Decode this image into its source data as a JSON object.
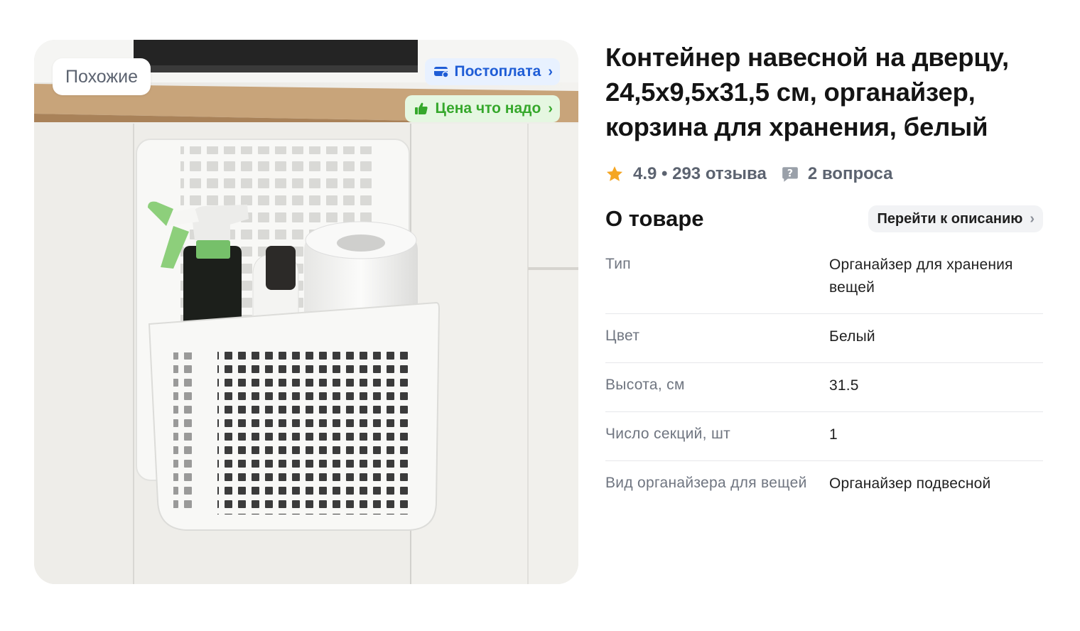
{
  "gallery": {
    "similar_label": "Похожие",
    "badges": [
      {
        "label": "Постоплата",
        "color": "#1f5dd6",
        "background": "#e8f1ff",
        "icon": "card-icon"
      },
      {
        "label": "Цена что надо",
        "color": "#36a82c",
        "background": "#e5f7e1",
        "icon": "thumbs-up-icon"
      }
    ]
  },
  "product": {
    "title": "Контейнер навесной на дверцу, 24,5х9,5х31,5 см, органайзер, корзина для хранения, белый",
    "rating": "4.9",
    "reviews": "293 отзыва",
    "rating_reviews_text": "4.9 • 293 отзыва",
    "questions": "2 вопроса",
    "star_color": "#f5a623"
  },
  "about": {
    "title": "О товаре",
    "goto_label": "Перейти к описанию",
    "specs": [
      {
        "key": "Тип",
        "value": "Органайзер для хранения вещей"
      },
      {
        "key": "Цвет",
        "value": "Белый"
      },
      {
        "key": "Высота, см",
        "value": "31.5"
      },
      {
        "key": "Число секций, шт",
        "value": "1"
      },
      {
        "key": "Вид органайзера для вещей",
        "value": "Органайзер подвесной"
      }
    ]
  }
}
